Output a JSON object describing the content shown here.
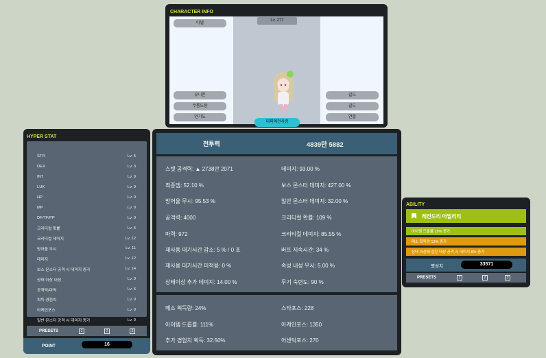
{
  "character": {
    "title": "CHARACTER INFO",
    "level": "Lv. 277",
    "left_pills": [
      "아델",
      "유니온",
      "무릉도장",
      "인기도"
    ],
    "right_pills": [
      "길드",
      "길드",
      "연합"
    ],
    "cyan_pill": "대피예전사랑"
  },
  "hyper": {
    "title": "HYPER STAT",
    "rows": [
      {
        "name": "STR",
        "level": "Lv. 5"
      },
      {
        "name": "DEX",
        "level": "Lv. 3"
      },
      {
        "name": "INT",
        "level": "Lv. 0"
      },
      {
        "name": "LUK",
        "level": "Lv. 0"
      },
      {
        "name": "HP",
        "level": "Lv. 0"
      },
      {
        "name": "MP",
        "level": "Lv. 0"
      },
      {
        "name": "DF/TF/PP",
        "level": "Lv. 0"
      },
      {
        "name": "크리티컬 확률",
        "level": "Lv. 6"
      },
      {
        "name": "크리티컬 데미지",
        "level": "Lv. 12"
      },
      {
        "name": "방어율 무시",
        "level": "Lv. 11"
      },
      {
        "name": "데미지",
        "level": "Lv. 12"
      },
      {
        "name": "보스 몬스터 공격 시 데미지 증가",
        "level": "Lv. 14"
      },
      {
        "name": "상태 이상 내성",
        "level": "Lv. 0"
      },
      {
        "name": "공격력/마력",
        "level": "Lv. 6"
      },
      {
        "name": "획득 경험치",
        "level": "Lv. 0"
      },
      {
        "name": "아케인포스",
        "level": "Lv. 0"
      },
      {
        "name": "일반 몬스터 공격 시 데미지 증가",
        "level": "Lv. 0"
      }
    ],
    "presets_label": "PRESETS",
    "presets": [
      "1",
      "2",
      "3"
    ],
    "point_label": "POINT",
    "point_value": "16"
  },
  "stats": {
    "power_label": "전투력",
    "power_value": "4839만 5882",
    "group1_left": [
      "스탯 공격력: ▲ 2738만 2071",
      "최종뎀: 52.10 %",
      "방어율 무시: 95.53 %",
      "공격력: 4000",
      "마력: 972",
      "재사용 대기시간 감소: 5 % / 0 초",
      "재사용 대기시간 미적용: 0 %",
      "상태이상 추가 데미지: 14.00 %"
    ],
    "group1_right": [
      "데미지: 93.00 %",
      "보스 몬스터 데미지: 427.00 %",
      "일반 몬스터 데미지: 32.00 %",
      "크리티컬 확률: 109 %",
      "크리티컬 데미지: 85.55 %",
      "버프 지속시간: 34 %",
      "속성 내성 무시: 5.00 %",
      "무기 숙련도: 90 %"
    ],
    "group2_left": [
      "메소 획득량: 24%",
      "아이템 드롭률: 111%",
      "추가 경험치 획득: 32.50%"
    ],
    "group2_right": [
      "스타포스: 228",
      "아케인포스: 1350",
      "어센틱포스: 270"
    ]
  },
  "ability": {
    "title": "ABILITY",
    "grade": "레전드리 어빌리티",
    "lines": [
      {
        "text": "아이템 드롭률 19% 증가",
        "color": "#9fbf15"
      },
      {
        "text": "메소 획득량 13% 증가",
        "color": "#e09a10"
      },
      {
        "text": "상태 이상에 걸린 대상 공격 시 데미지 8% 증가",
        "color": "#e09a10"
      }
    ],
    "fame_label": "명성치",
    "fame_value": "33571",
    "presets_label": "PRESETS",
    "presets": [
      "1",
      "2",
      "3"
    ]
  }
}
